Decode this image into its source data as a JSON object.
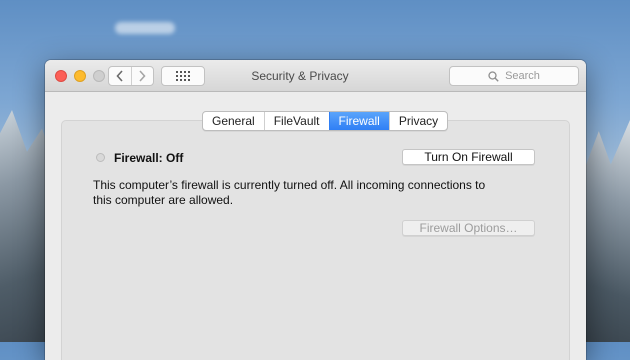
{
  "window": {
    "title": "Security & Privacy",
    "search_placeholder": "Search"
  },
  "tabs": [
    {
      "label": "General",
      "active": false
    },
    {
      "label": "FileVault",
      "active": false
    },
    {
      "label": "Firewall",
      "active": true
    },
    {
      "label": "Privacy",
      "active": false
    }
  ],
  "firewall": {
    "status_label": "Firewall: Off",
    "turn_on_button": "Turn On Firewall",
    "description": "This computer’s firewall is currently turned off. All incoming connections to this computer are allowed.",
    "options_button": "Firewall Options…"
  },
  "colors": {
    "accent": "#2f7ff5",
    "close": "#fc5f57",
    "minimize": "#fdbb2e",
    "zoom_disabled": "#cfcfcf"
  },
  "icons": {
    "back": "chevron-left-icon",
    "forward": "chevron-right-icon",
    "show_all": "grid-icon",
    "search": "search-icon"
  }
}
